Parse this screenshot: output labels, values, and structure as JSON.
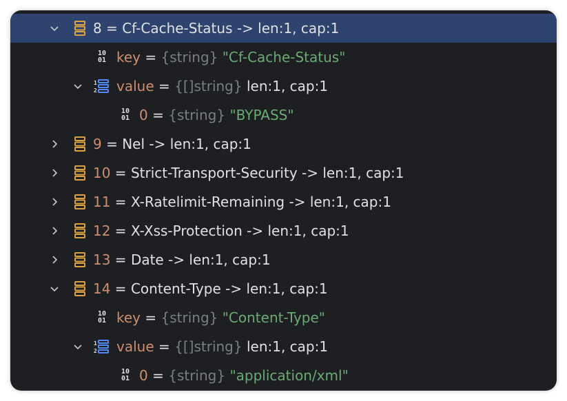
{
  "colors": {
    "background": "#1e1f22",
    "selection": "#2e436e",
    "orange": "#cf8e6d",
    "gray": "#7a7e85",
    "green": "#6aab73",
    "text": "#dfe1e5",
    "map_icon": "#d9a343",
    "list_icon": "#548af7"
  },
  "rows": [
    {
      "chevron": "chevron-down-icon",
      "icon": "map-entry-icon",
      "name": "8",
      "eq": " = ",
      "desc": "Cf-Cache-Status -> len:1, cap:1"
    },
    {
      "icon": "binary-icon",
      "name": "key",
      "eq": " = ",
      "type": "{string}",
      "value": "\"Cf-Cache-Status\""
    },
    {
      "chevron": "chevron-down-icon",
      "icon": "list-icon",
      "name": "value",
      "eq": " = ",
      "type": "{[]string}",
      "desc": "len:1, cap:1"
    },
    {
      "icon": "binary-icon",
      "name": "0",
      "eq": " = ",
      "type": "{string}",
      "value": "\"BYPASS\""
    },
    {
      "chevron": "chevron-right-icon",
      "icon": "map-entry-icon",
      "name": "9",
      "eq": " = ",
      "desc": "Nel -> len:1, cap:1"
    },
    {
      "chevron": "chevron-right-icon",
      "icon": "map-entry-icon",
      "name": "10",
      "eq": " = ",
      "desc": "Strict-Transport-Security -> len:1, cap:1"
    },
    {
      "chevron": "chevron-right-icon",
      "icon": "map-entry-icon",
      "name": "11",
      "eq": " = ",
      "desc": "X-Ratelimit-Remaining -> len:1, cap:1"
    },
    {
      "chevron": "chevron-right-icon",
      "icon": "map-entry-icon",
      "name": "12",
      "eq": " = ",
      "desc": "X-Xss-Protection -> len:1, cap:1"
    },
    {
      "chevron": "chevron-right-icon",
      "icon": "map-entry-icon",
      "name": "13",
      "eq": " = ",
      "desc": "Date -> len:1, cap:1"
    },
    {
      "chevron": "chevron-down-icon",
      "icon": "map-entry-icon",
      "name": "14",
      "eq": " = ",
      "desc": "Content-Type -> len:1, cap:1"
    },
    {
      "icon": "binary-icon",
      "name": "key",
      "eq": " = ",
      "type": "{string}",
      "value": "\"Content-Type\""
    },
    {
      "chevron": "chevron-down-icon",
      "icon": "list-icon",
      "name": "value",
      "eq": " = ",
      "type": "{[]string}",
      "desc": "len:1, cap:1"
    },
    {
      "icon": "binary-icon",
      "name": "0",
      "eq": " = ",
      "type": "{string}",
      "value": "\"application/xml\""
    }
  ]
}
